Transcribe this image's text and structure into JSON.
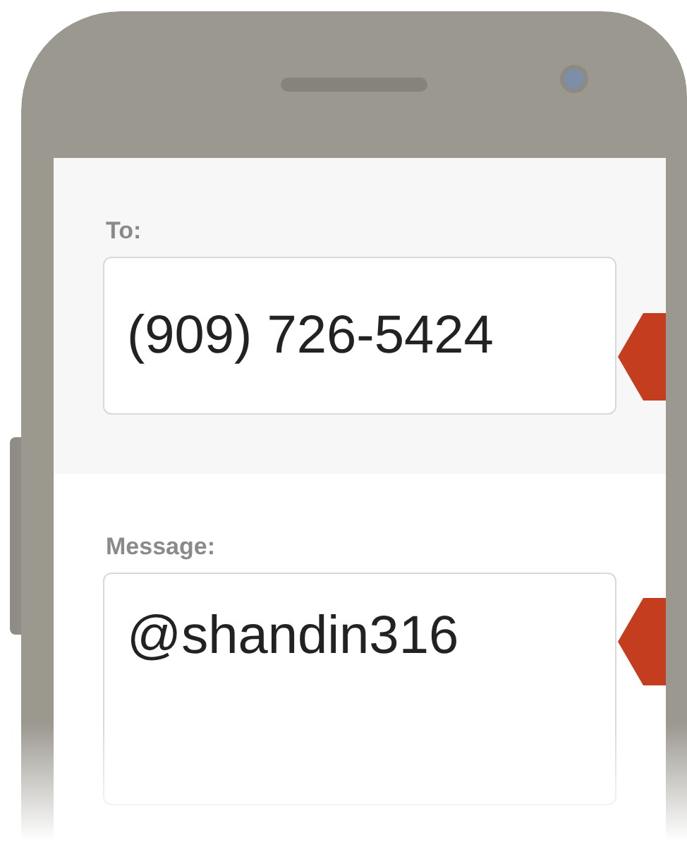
{
  "form": {
    "fields": [
      {
        "kind": "line",
        "label": "To:",
        "value": "(909) 726-5424"
      },
      {
        "kind": "area",
        "label": "Message:",
        "value": "@shandin316"
      }
    ]
  }
}
